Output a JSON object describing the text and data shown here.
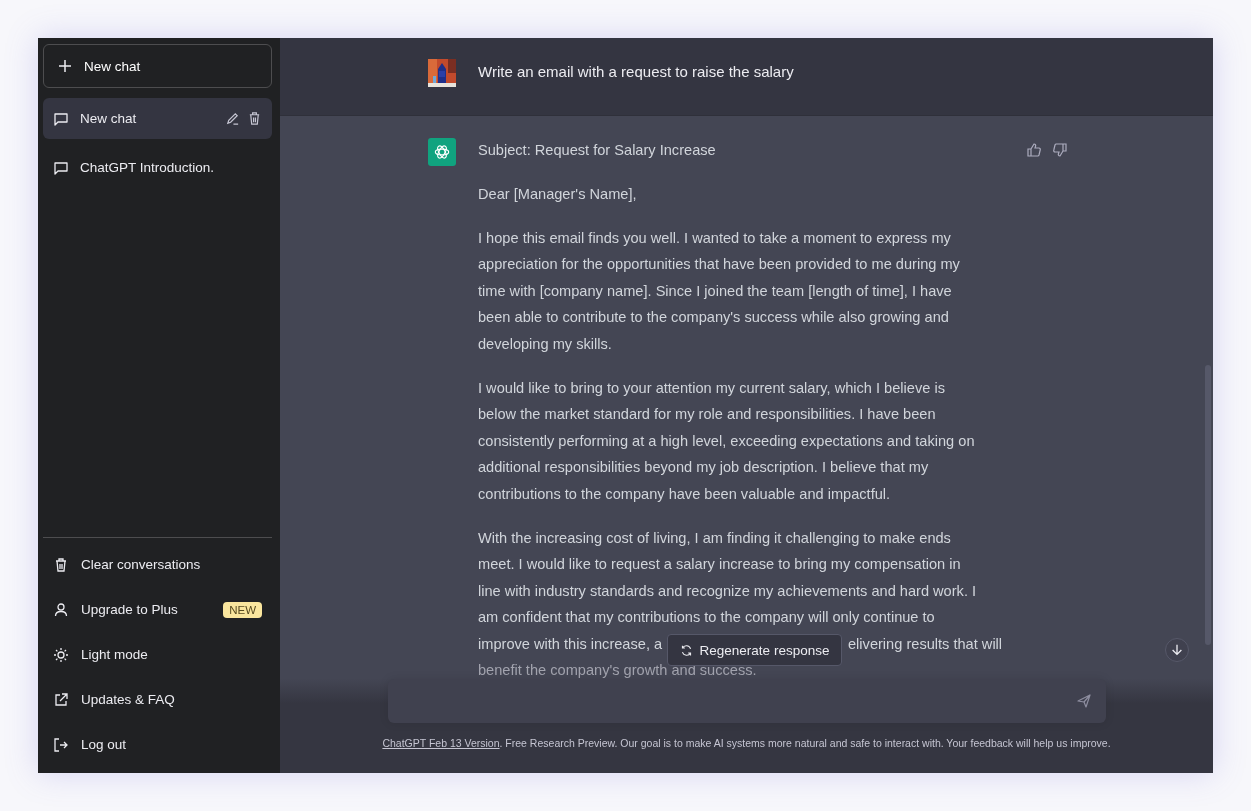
{
  "sidebar": {
    "new_chat_button": "New chat",
    "history": [
      {
        "title": "New chat",
        "selected": true
      },
      {
        "title": "ChatGPT Introduction.",
        "selected": false
      }
    ],
    "menu": [
      {
        "kind": "clear",
        "label": "Clear conversations"
      },
      {
        "kind": "upgrade",
        "label": "Upgrade to Plus",
        "badge": "NEW"
      },
      {
        "kind": "theme",
        "label": "Light mode"
      },
      {
        "kind": "link",
        "label": "Updates & FAQ"
      },
      {
        "kind": "logout",
        "label": "Log out"
      }
    ]
  },
  "conversation": {
    "user_message": "Write an email with a request to raise the salary",
    "reply": {
      "subject": "Subject: Request for Salary Increase",
      "paragraphs": [
        "Dear [Manager's Name],",
        "I hope this email finds you well. I wanted to take a moment to express my\nappreciation for the opportunities that have been provided to me during my\ntime with [company name]. Since I joined the team [length of time], I have\nbeen able to contribute to the company's success while also growing and\ndeveloping my skills.",
        "I would like to bring to your attention my current salary, which I believe is\nbelow the market standard for my role and responsibilities. I have been\nconsistently performing at a high level, exceeding expectations and taking on\nadditional responsibilities beyond my job description. I believe that my\ncontributions to the company have been valuable and impactful."
      ],
      "last_paragraph": {
        "before": "With the increasing cost of living, I am finding it challenging to make ends\nmeet. I would like to request a salary increase to bring my compensation in\nline with industry standards and recognize my achievements and hard work. I\nam confident that my contributions to the company will only continue to",
        "covered_line": [
          "improve with this increase, a",
          "elivering results that will"
        ],
        "after": "benefit the company's growth and success."
      }
    }
  },
  "regenerate_button": "Regenerate response",
  "footer": {
    "link": "ChatGPT Feb 13 Version",
    "text": ". Free Research Preview. Our goal is to make AI systems more natural and safe to interact with. Your feedback will help us improve."
  }
}
